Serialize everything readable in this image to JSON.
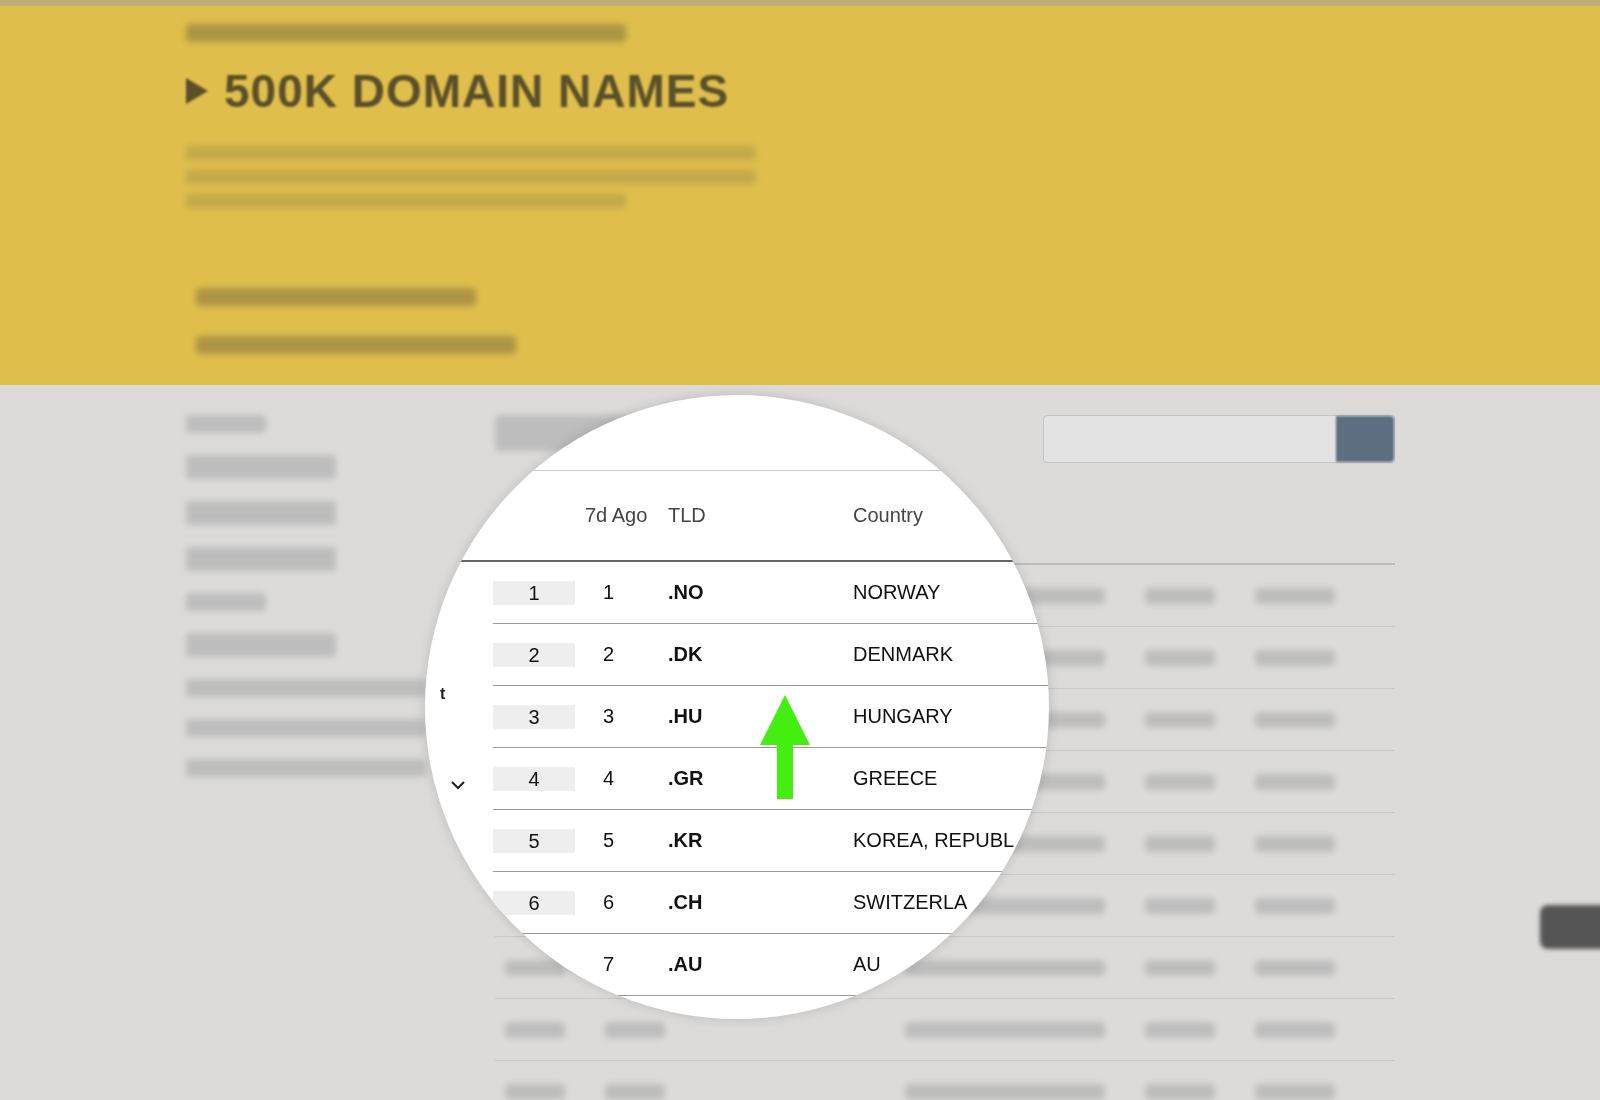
{
  "header": {
    "title": "500K DOMAIN NAMES"
  },
  "magnifier": {
    "side_text": "t",
    "columns": [
      "7d Ago",
      "TLD",
      "Country"
    ],
    "rows": [
      {
        "rank": "1",
        "ago": "1",
        "tld": ".NO",
        "country": "NORWAY"
      },
      {
        "rank": "2",
        "ago": "2",
        "tld": ".DK",
        "country": "DENMARK"
      },
      {
        "rank": "3",
        "ago": "3",
        "tld": ".HU",
        "country": "HUNGARY"
      },
      {
        "rank": "4",
        "ago": "4",
        "tld": ".GR",
        "country": "GREECE"
      },
      {
        "rank": "5",
        "ago": "5",
        "tld": ".KR",
        "country": "KOREA, REPUBL"
      },
      {
        "rank": "6",
        "ago": "6",
        "tld": ".CH",
        "country": "SWITZERLA"
      },
      {
        "ago": "7",
        "tld": ".AU",
        "country": "AU"
      }
    ]
  }
}
